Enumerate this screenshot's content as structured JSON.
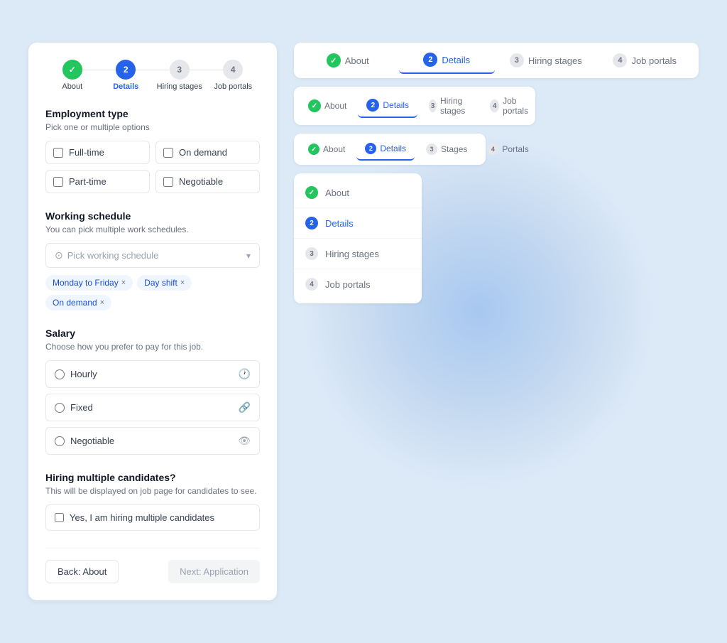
{
  "background": {
    "color": "#dce9f7"
  },
  "left_panel": {
    "stepper": {
      "steps": [
        {
          "id": "about",
          "number": "✓",
          "label": "About",
          "state": "completed"
        },
        {
          "id": "details",
          "number": "2",
          "label": "Details",
          "state": "active"
        },
        {
          "id": "hiring",
          "number": "3",
          "label": "Hiring stages",
          "state": "inactive"
        },
        {
          "id": "portals",
          "number": "4",
          "label": "Job portals",
          "state": "inactive"
        }
      ]
    },
    "employment_type": {
      "title": "Employment type",
      "subtitle": "Pick one or multiple options",
      "options": [
        {
          "id": "full-time",
          "label": "Full-time",
          "checked": false
        },
        {
          "id": "on-demand",
          "label": "On demand",
          "checked": false
        },
        {
          "id": "part-time",
          "label": "Part-time",
          "checked": false
        },
        {
          "id": "negotiable",
          "label": "Negotiable",
          "checked": false
        }
      ]
    },
    "working_schedule": {
      "title": "Working schedule",
      "subtitle": "You can pick multiple work schedules.",
      "placeholder": "Pick working schedule",
      "tags": [
        {
          "label": "Monday to Friday"
        },
        {
          "label": "Day shift"
        },
        {
          "label": "On demand"
        }
      ]
    },
    "salary": {
      "title": "Salary",
      "subtitle": "Choose how you prefer to pay for this job.",
      "options": [
        {
          "id": "hourly",
          "label": "Hourly",
          "icon": "clock"
        },
        {
          "id": "fixed",
          "label": "Fixed",
          "icon": "link"
        },
        {
          "id": "negotiable",
          "label": "Negotiable",
          "icon": "eye-off"
        }
      ]
    },
    "hiring": {
      "title": "Hiring multiple candidates?",
      "subtitle": "This will be displayed on job page for candidates to see.",
      "checkbox_label": "Yes, I am hiring multiple candidates"
    },
    "footer": {
      "back_label": "Back: About",
      "next_label": "Next: Application"
    }
  },
  "right_panel": {
    "tab_bar_large": {
      "tabs": [
        {
          "id": "about",
          "label": "About",
          "badge": "✓",
          "badge_type": "green",
          "active": false
        },
        {
          "id": "details",
          "label": "Details",
          "badge": "2",
          "badge_type": "blue",
          "active": true
        },
        {
          "id": "hiring",
          "label": "Hiring stages",
          "badge": "3",
          "badge_type": "gray",
          "active": false
        },
        {
          "id": "portals",
          "label": "Job portals",
          "badge": "4",
          "badge_type": "gray",
          "active": false
        }
      ]
    },
    "tab_bar_medium": {
      "tabs": [
        {
          "id": "about",
          "label": "About",
          "badge": "✓",
          "badge_type": "green",
          "active": false
        },
        {
          "id": "details",
          "label": "Details",
          "badge": "2",
          "badge_type": "blue",
          "active": true
        },
        {
          "id": "hiring",
          "label": "Hiring stages",
          "badge": "3",
          "badge_type": "gray",
          "active": false
        },
        {
          "id": "portals",
          "label": "Job portals",
          "badge": "4",
          "badge_type": "gray",
          "active": false
        }
      ]
    },
    "tab_bar_small": {
      "tabs": [
        {
          "id": "about",
          "label": "About",
          "badge": "✓",
          "badge_type": "green",
          "active": false
        },
        {
          "id": "details",
          "label": "Details",
          "badge": "2",
          "badge_type": "blue",
          "active": true
        },
        {
          "id": "stages",
          "label": "Stages",
          "badge": "3",
          "badge_type": "gray",
          "active": false
        },
        {
          "id": "portals",
          "label": "Portals",
          "badge": "4",
          "badge_type": "gray",
          "active": false
        }
      ]
    },
    "vertical_list": {
      "items": [
        {
          "id": "about",
          "label": "About",
          "badge": "✓",
          "badge_type": "green"
        },
        {
          "id": "details",
          "label": "Details",
          "badge": "2",
          "badge_type": "blue"
        },
        {
          "id": "hiring",
          "label": "Hiring stages",
          "badge": "3",
          "badge_type": "gray"
        },
        {
          "id": "portals",
          "label": "Job portals",
          "badge": "4",
          "badge_type": "gray"
        }
      ]
    }
  }
}
